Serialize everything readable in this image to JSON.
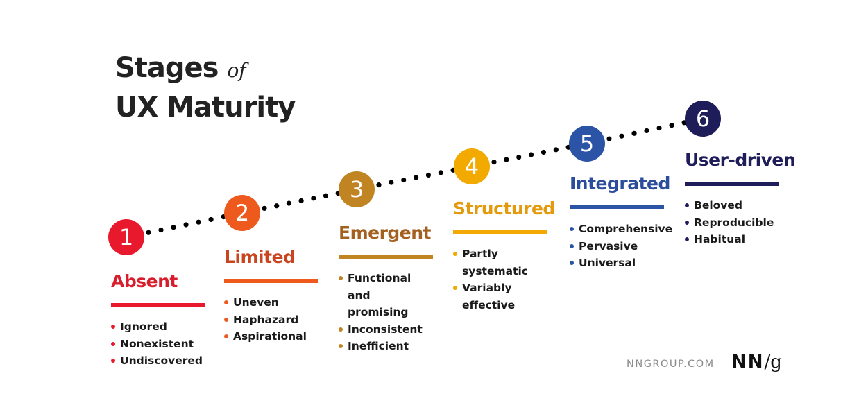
{
  "title": {
    "line1": "Stages",
    "of": "of",
    "line2": "UX Maturity"
  },
  "stages": [
    {
      "number": "1",
      "name": "Absent",
      "color": "#e8192c",
      "heading_color": "#d81e2c",
      "bar_color": "#e8192c",
      "traits": [
        "Ignored",
        "Nonexistent",
        "Undiscovered"
      ]
    },
    {
      "number": "2",
      "name": "Limited",
      "color": "#ee5a1e",
      "heading_color": "#c9441f",
      "bar_color": "#ee5a1e",
      "traits": [
        "Uneven",
        "Haphazard",
        "Aspirational"
      ]
    },
    {
      "number": "3",
      "name": "Emergent",
      "color": "#c18422",
      "heading_color": "#a4601f",
      "bar_color": "#c18422",
      "traits": [
        "Functional and promising",
        "Inconsistent",
        "Inefficient"
      ]
    },
    {
      "number": "4",
      "name": "Structured",
      "color": "#f2a900",
      "heading_color": "#e39a0c",
      "bar_color": "#f2a900",
      "traits": [
        "Partly systematic",
        "Variably effective"
      ]
    },
    {
      "number": "5",
      "name": "Integrated",
      "color": "#2c54a6",
      "heading_color": "#2c4c9c",
      "bar_color": "#2c54a6",
      "traits": [
        "Comprehensive",
        "Pervasive",
        "Universal"
      ]
    },
    {
      "number": "6",
      "name": "User-driven",
      "color": "#1f1c5a",
      "heading_color": "#1f1c5a",
      "bar_color": "#1f1c5a",
      "traits": [
        "Beloved",
        "Reproducible",
        "Habitual"
      ]
    }
  ],
  "footer": {
    "url": "NNGROUP.COM",
    "logo_nn": "NN",
    "logo_slash": "/",
    "logo_g": "g"
  }
}
